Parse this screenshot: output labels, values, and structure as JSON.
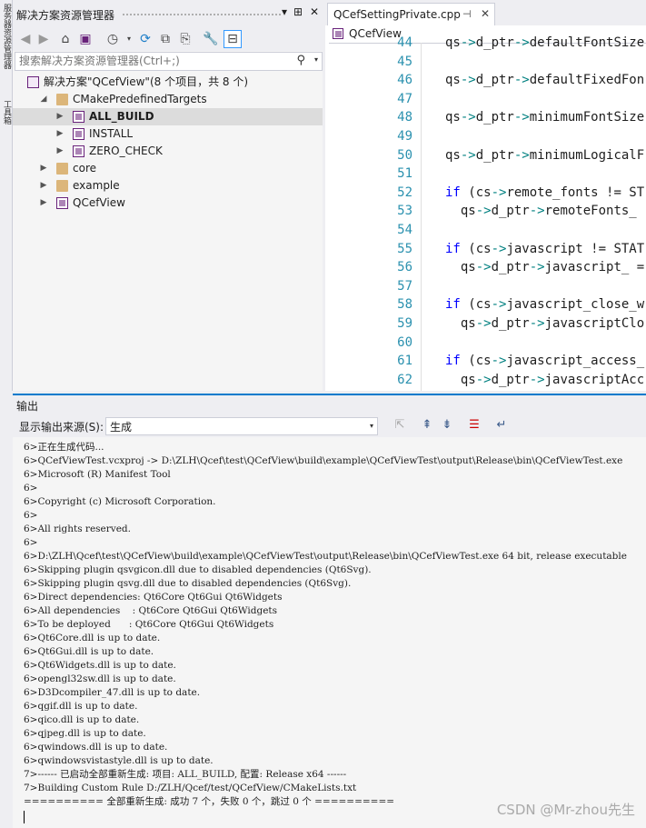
{
  "left_strip": {
    "text_top": "服务器资源管理器",
    "text_bottom": "工具箱"
  },
  "solution_explorer": {
    "title": "解决方案资源管理器",
    "title_buttons": [
      "▾",
      "⊞",
      "✕"
    ],
    "search_placeholder": "搜索解决方案资源管理器(Ctrl+;)",
    "tree": [
      {
        "label": "解决方案\"QCefView\"(8 个项目，共 8 个)",
        "icon": "solution-icon",
        "level": 0,
        "arrow": "",
        "selected": false,
        "bold": false
      },
      {
        "label": "CMakePredefinedTargets",
        "icon": "folder-icon",
        "level": 1,
        "arrow": "◢",
        "selected": false,
        "bold": false
      },
      {
        "label": "ALL_BUILD",
        "icon": "project-icon",
        "level": 2,
        "arrow": "▶",
        "selected": true,
        "bold": true
      },
      {
        "label": "INSTALL",
        "icon": "project-icon",
        "level": 2,
        "arrow": "▶",
        "selected": false,
        "bold": false
      },
      {
        "label": "ZERO_CHECK",
        "icon": "project-icon",
        "level": 2,
        "arrow": "▶",
        "selected": false,
        "bold": false
      },
      {
        "label": "core",
        "icon": "folder-icon",
        "level": 1,
        "arrow": "▶",
        "selected": false,
        "bold": false
      },
      {
        "label": "example",
        "icon": "folder-icon",
        "level": 1,
        "arrow": "▶",
        "selected": false,
        "bold": false
      },
      {
        "label": "QCefView",
        "icon": "project-icon",
        "level": 1,
        "arrow": "▶",
        "selected": false,
        "bold": false
      }
    ]
  },
  "editor": {
    "tab_name": "QCefSettingPrivate.cpp",
    "tab_pin": "⊣",
    "tab_close": "✕",
    "nav_scope": "QCefView",
    "line_numbers": [
      "44",
      "45",
      "46",
      "47",
      "48",
      "49",
      "50",
      "51",
      "52",
      "53",
      "54",
      "55",
      "56",
      "57",
      "58",
      "59",
      "60",
      "61",
      "62"
    ],
    "lines": [
      "qs->d_ptr->defaultFontSize",
      "",
      "qs->d_ptr->defaultFixedFon",
      "",
      "qs->d_ptr->minimumFontSize",
      "",
      "qs->d_ptr->minimumLogicalF",
      "",
      "if (cs->remote_fonts != ST",
      "  qs->d_ptr->remoteFonts_",
      "",
      "if (cs->javascript != STAT",
      "  qs->d_ptr->javascript_ =",
      "",
      "if (cs->javascript_close_w",
      "  qs->d_ptr->javascriptClo",
      "",
      "if (cs->javascript_access_",
      "  qs->d_ptr->javascriptAcc"
    ]
  },
  "output": {
    "title": "输出",
    "source_label": "显示输出来源(S):",
    "source_value": "生成",
    "log_lines": [
      "6>正在生成代码...",
      "6>QCefViewTest.vcxproj -> D:\\ZLH\\Qcef\\test\\QCefView\\build\\example\\QCefViewTest\\output\\Release\\bin\\QCefViewTest.exe",
      "6>Microsoft (R) Manifest Tool",
      "6>",
      "6>Copyright (c) Microsoft Corporation.",
      "6>",
      "6>All rights reserved.",
      "6>",
      "6>D:\\ZLH\\Qcef\\test\\QCefView\\build\\example\\QCefViewTest\\output\\Release\\bin\\QCefViewTest.exe 64 bit, release executable",
      "6>Skipping plugin qsvgicon.dll due to disabled dependencies (Qt6Svg).",
      "6>Skipping plugin qsvg.dll due to disabled dependencies (Qt6Svg).",
      "6>Direct dependencies: Qt6Core Qt6Gui Qt6Widgets",
      "6>All dependencies    : Qt6Core Qt6Gui Qt6Widgets",
      "6>To be deployed      : Qt6Core Qt6Gui Qt6Widgets",
      "6>Qt6Core.dll is up to date.",
      "6>Qt6Gui.dll is up to date.",
      "6>Qt6Widgets.dll is up to date.",
      "6>opengl32sw.dll is up to date.",
      "6>D3Dcompiler_47.dll is up to date.",
      "6>qgif.dll is up to date.",
      "6>qico.dll is up to date.",
      "6>qjpeg.dll is up to date.",
      "6>qwindows.dll is up to date.",
      "6>qwindowsvistastyle.dll is up to date.",
      "7>------ 已启动全部重新生成: 项目: ALL_BUILD, 配置: Release x64 ------",
      "7>Building Custom Rule D:/ZLH/Qcef/test/QCefView/CMakeLists.txt",
      "========== 全部重新生成: 成功 7 个，失败 0 个，跳过 0 个 =========="
    ]
  },
  "watermark": "CSDN @Mr-zhou先生",
  "colors": {
    "accent": "#007acc",
    "line_number": "#2b91af",
    "keyword": "#0000ff",
    "selected_row": "#dcdcdc"
  }
}
